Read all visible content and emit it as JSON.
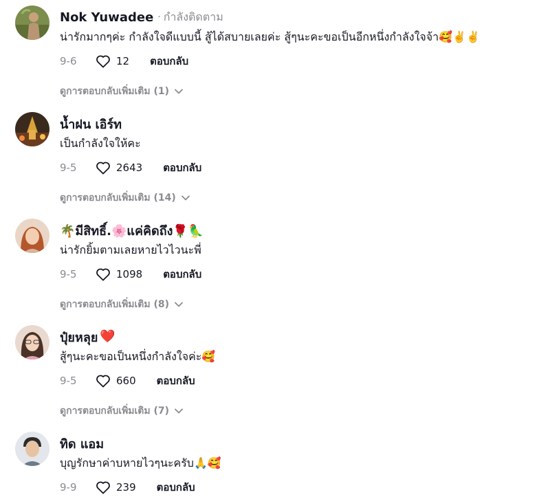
{
  "comments": [
    {
      "username": "Nok Yuwadee",
      "separator": "·",
      "follow_status": "กำลังติดตาม",
      "name_emojis": "",
      "text": "น่ารักมากๆค่ะ กำลังใจดีแบบนี้ สู้ได้สบายเลยค่ะ สู้ๆนะคะขอเป็นอีกหนึ่งกำลังใจจ้า🥰✌️✌️",
      "date": "9-6",
      "likes": "12",
      "reply_label": "ตอบกลับ",
      "more_replies": "ดูการตอบกลับเพิ่มเติม (1)"
    },
    {
      "username": "น้ำฝน เอิร์ท",
      "separator": "",
      "follow_status": "",
      "name_emojis": "",
      "text": "เป็นกำลังใจให้คะ",
      "date": "9-5",
      "likes": "2643",
      "reply_label": "ตอบกลับ",
      "more_replies": "ดูการตอบกลับเพิ่มเติม (14)"
    },
    {
      "username": "🌴มีสิทธิ์.🌸แค่คิดถึง🌹🦜",
      "separator": "",
      "follow_status": "",
      "name_emojis": "",
      "text": "น่ารักยิ้มตามเลยหายไวไวนะพี่",
      "date": "9-5",
      "likes": "1098",
      "reply_label": "ตอบกลับ",
      "more_replies": "ดูการตอบกลับเพิ่มเติม (8)"
    },
    {
      "username": "ปุ๋ยหลุย",
      "separator": "",
      "follow_status": "",
      "name_emojis": "❤️",
      "text": "สู้ๆนะคะขอเป็นหนึ่งกำลังใจค่ะ🥰",
      "date": "9-5",
      "likes": "660",
      "reply_label": "ตอบกลับ",
      "more_replies": "ดูการตอบกลับเพิ่มเติม (7)"
    },
    {
      "username": "ทิด แอม",
      "separator": "",
      "follow_status": "",
      "name_emojis": "",
      "text": "บุญรักษาค่าบหายไวๆนะครับ🙏🥰",
      "date": "9-9",
      "likes": "239",
      "reply_label": "ตอบกลับ",
      "more_replies": ""
    }
  ],
  "icons": {
    "like": "heart-outline-icon",
    "expand": "chevron-down-icon"
  },
  "colors": {
    "primary_text": "#161823",
    "secondary_text": "#8a8b91"
  }
}
